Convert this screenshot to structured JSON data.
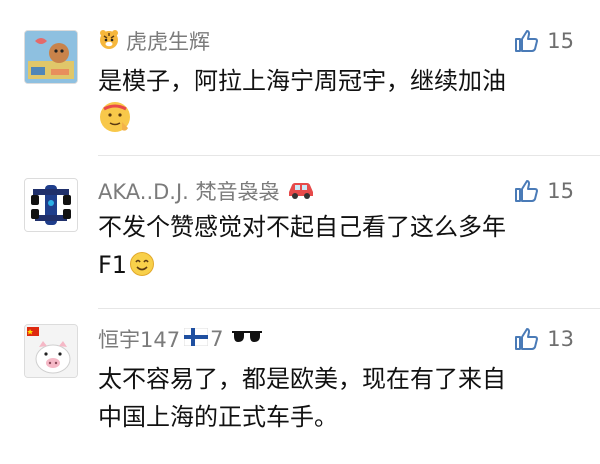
{
  "comments": [
    {
      "username": "虎虎生辉",
      "likes": "15",
      "lines": [
        "是模子，阿拉上海宁周冠宇，继续加油"
      ],
      "avatar_icon": "tiger-collage-avatar",
      "trailing_emoji": "salute-emoji"
    },
    {
      "username": "AKA..D.J. 梵音袅袅",
      "likes": "15",
      "lines": [
        "不发个赞感觉对不起自己看了这么多年",
        "F1"
      ],
      "avatar_icon": "f1-car-avatar",
      "trailing_emoji": "smile-emoji"
    },
    {
      "username": "恒宇147",
      "username_suffix": "7",
      "likes": "13",
      "lines": [
        "太不容易了，都是欧美，现在有了来自",
        "中国上海的正式车手。"
      ],
      "avatar_icon": "pig-flag-avatar"
    }
  ],
  "colors": {
    "text": "#111111",
    "meta": "#7b7b7b",
    "like": "#6e6e6e",
    "divider": "#e6e6e6"
  }
}
